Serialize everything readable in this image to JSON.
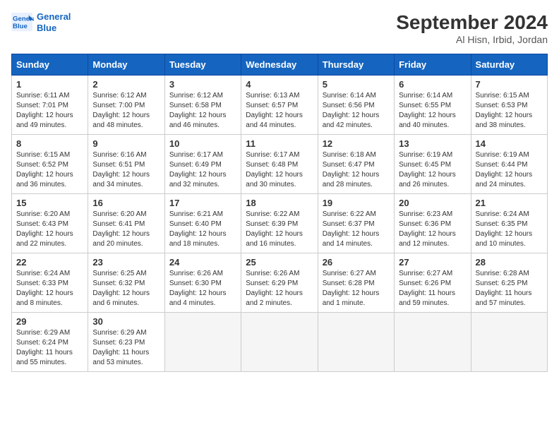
{
  "header": {
    "logo_line1": "General",
    "logo_line2": "Blue",
    "month_title": "September 2024",
    "location": "Al Hisn, Irbid, Jordan"
  },
  "days_of_week": [
    "Sunday",
    "Monday",
    "Tuesday",
    "Wednesday",
    "Thursday",
    "Friday",
    "Saturday"
  ],
  "weeks": [
    [
      {
        "day": "1",
        "detail": "Sunrise: 6:11 AM\nSunset: 7:01 PM\nDaylight: 12 hours\nand 49 minutes."
      },
      {
        "day": "2",
        "detail": "Sunrise: 6:12 AM\nSunset: 7:00 PM\nDaylight: 12 hours\nand 48 minutes."
      },
      {
        "day": "3",
        "detail": "Sunrise: 6:12 AM\nSunset: 6:58 PM\nDaylight: 12 hours\nand 46 minutes."
      },
      {
        "day": "4",
        "detail": "Sunrise: 6:13 AM\nSunset: 6:57 PM\nDaylight: 12 hours\nand 44 minutes."
      },
      {
        "day": "5",
        "detail": "Sunrise: 6:14 AM\nSunset: 6:56 PM\nDaylight: 12 hours\nand 42 minutes."
      },
      {
        "day": "6",
        "detail": "Sunrise: 6:14 AM\nSunset: 6:55 PM\nDaylight: 12 hours\nand 40 minutes."
      },
      {
        "day": "7",
        "detail": "Sunrise: 6:15 AM\nSunset: 6:53 PM\nDaylight: 12 hours\nand 38 minutes."
      }
    ],
    [
      {
        "day": "8",
        "detail": "Sunrise: 6:15 AM\nSunset: 6:52 PM\nDaylight: 12 hours\nand 36 minutes."
      },
      {
        "day": "9",
        "detail": "Sunrise: 6:16 AM\nSunset: 6:51 PM\nDaylight: 12 hours\nand 34 minutes."
      },
      {
        "day": "10",
        "detail": "Sunrise: 6:17 AM\nSunset: 6:49 PM\nDaylight: 12 hours\nand 32 minutes."
      },
      {
        "day": "11",
        "detail": "Sunrise: 6:17 AM\nSunset: 6:48 PM\nDaylight: 12 hours\nand 30 minutes."
      },
      {
        "day": "12",
        "detail": "Sunrise: 6:18 AM\nSunset: 6:47 PM\nDaylight: 12 hours\nand 28 minutes."
      },
      {
        "day": "13",
        "detail": "Sunrise: 6:19 AM\nSunset: 6:45 PM\nDaylight: 12 hours\nand 26 minutes."
      },
      {
        "day": "14",
        "detail": "Sunrise: 6:19 AM\nSunset: 6:44 PM\nDaylight: 12 hours\nand 24 minutes."
      }
    ],
    [
      {
        "day": "15",
        "detail": "Sunrise: 6:20 AM\nSunset: 6:43 PM\nDaylight: 12 hours\nand 22 minutes."
      },
      {
        "day": "16",
        "detail": "Sunrise: 6:20 AM\nSunset: 6:41 PM\nDaylight: 12 hours\nand 20 minutes."
      },
      {
        "day": "17",
        "detail": "Sunrise: 6:21 AM\nSunset: 6:40 PM\nDaylight: 12 hours\nand 18 minutes."
      },
      {
        "day": "18",
        "detail": "Sunrise: 6:22 AM\nSunset: 6:39 PM\nDaylight: 12 hours\nand 16 minutes."
      },
      {
        "day": "19",
        "detail": "Sunrise: 6:22 AM\nSunset: 6:37 PM\nDaylight: 12 hours\nand 14 minutes."
      },
      {
        "day": "20",
        "detail": "Sunrise: 6:23 AM\nSunset: 6:36 PM\nDaylight: 12 hours\nand 12 minutes."
      },
      {
        "day": "21",
        "detail": "Sunrise: 6:24 AM\nSunset: 6:35 PM\nDaylight: 12 hours\nand 10 minutes."
      }
    ],
    [
      {
        "day": "22",
        "detail": "Sunrise: 6:24 AM\nSunset: 6:33 PM\nDaylight: 12 hours\nand 8 minutes."
      },
      {
        "day": "23",
        "detail": "Sunrise: 6:25 AM\nSunset: 6:32 PM\nDaylight: 12 hours\nand 6 minutes."
      },
      {
        "day": "24",
        "detail": "Sunrise: 6:26 AM\nSunset: 6:30 PM\nDaylight: 12 hours\nand 4 minutes."
      },
      {
        "day": "25",
        "detail": "Sunrise: 6:26 AM\nSunset: 6:29 PM\nDaylight: 12 hours\nand 2 minutes."
      },
      {
        "day": "26",
        "detail": "Sunrise: 6:27 AM\nSunset: 6:28 PM\nDaylight: 12 hours\nand 1 minute."
      },
      {
        "day": "27",
        "detail": "Sunrise: 6:27 AM\nSunset: 6:26 PM\nDaylight: 11 hours\nand 59 minutes."
      },
      {
        "day": "28",
        "detail": "Sunrise: 6:28 AM\nSunset: 6:25 PM\nDaylight: 11 hours\nand 57 minutes."
      }
    ],
    [
      {
        "day": "29",
        "detail": "Sunrise: 6:29 AM\nSunset: 6:24 PM\nDaylight: 11 hours\nand 55 minutes."
      },
      {
        "day": "30",
        "detail": "Sunrise: 6:29 AM\nSunset: 6:23 PM\nDaylight: 11 hours\nand 53 minutes."
      },
      {
        "day": "",
        "detail": ""
      },
      {
        "day": "",
        "detail": ""
      },
      {
        "day": "",
        "detail": ""
      },
      {
        "day": "",
        "detail": ""
      },
      {
        "day": "",
        "detail": ""
      }
    ]
  ]
}
